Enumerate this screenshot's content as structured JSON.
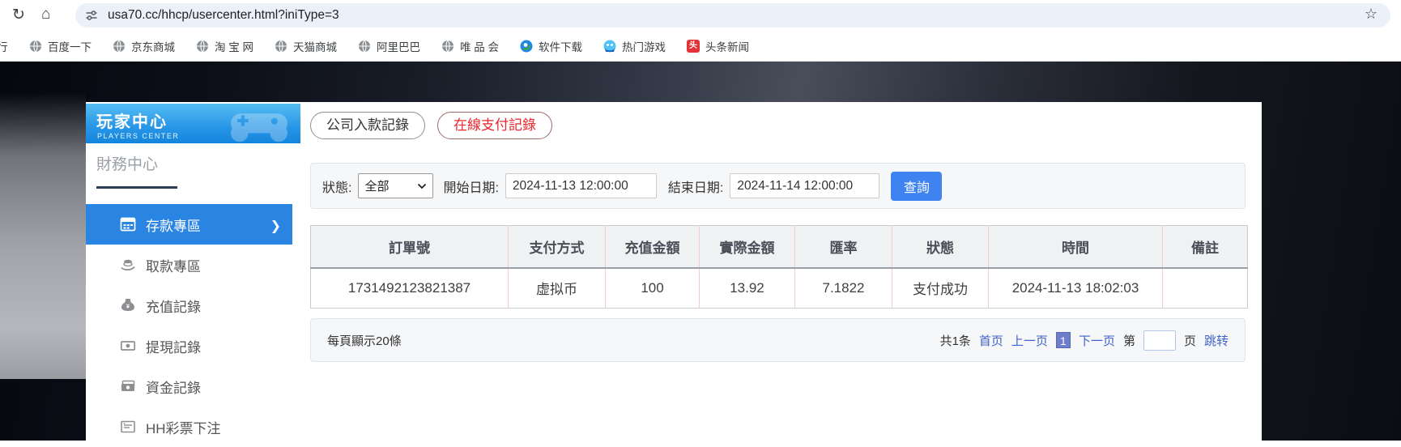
{
  "browser": {
    "url": "usa70.cc/hhcp/usercenter.html?iniType=3",
    "bookmark_cut": "行",
    "bookmarks": [
      "百度一下",
      "京东商城",
      "淘 宝 网",
      "天猫商城",
      "阿里巴巴",
      "唯 品 会",
      "软件下载",
      "热门游戏",
      "头条新闻"
    ],
    "toutiao_icon_text": "头"
  },
  "sidebar": {
    "title": "玩家中心",
    "subtitle": "PLAYERS CENTER",
    "section": "財務中心",
    "items": [
      "存款專區",
      "取款專區",
      "充值記錄",
      "提現記錄",
      "資金記錄",
      "HH彩票下注"
    ]
  },
  "tabs": {
    "company": "公司入款記錄",
    "online": "在線支付記錄"
  },
  "filters": {
    "status_label": "狀態:",
    "status_value": "全部",
    "start_label": "開始日期:",
    "start_value": "2024-11-13 12:00:00",
    "end_label": "結束日期:",
    "end_value": "2024-11-14 12:00:00",
    "search_label": "查詢"
  },
  "table": {
    "headers": [
      "訂單號",
      "支付方式",
      "充值金額",
      "實際金額",
      "匯率",
      "狀態",
      "時間",
      "備註"
    ],
    "rows": [
      [
        "1731492123821387",
        "虚拟币",
        "100",
        "13.92",
        "7.1822",
        "支付成功",
        "2024-11-13 18:02:03",
        ""
      ]
    ]
  },
  "pagination": {
    "page_size_text": "每頁顯示20條",
    "total": "共1条",
    "first": "首页",
    "prev": "上一页",
    "current": "1",
    "next": "下一页",
    "jump_prefix": "第",
    "jump_value": "",
    "jump_suffix": "页",
    "jump": "跳转"
  },
  "colors": {
    "accent_blue": "#2a85e2",
    "banner_top": "#55bdf2",
    "banner_bottom": "#1385dd",
    "tab_active_red": "#e8262d",
    "link_blue": "#3f63c8",
    "button_blue": "#3f83f1",
    "table_divider_pink": "#f2ccc6",
    "current_page_bg": "#6f7ecb"
  }
}
